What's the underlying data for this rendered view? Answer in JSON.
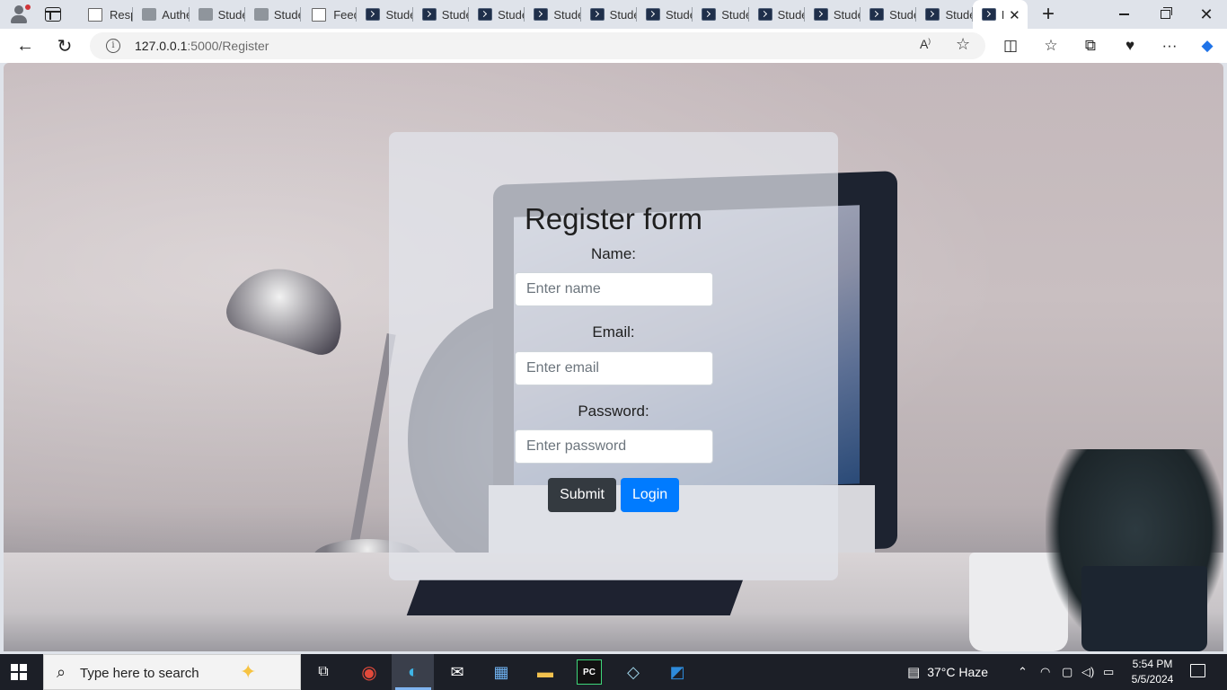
{
  "browser": {
    "tabs": [
      {
        "label": "Respo",
        "icon": "page-icon"
      },
      {
        "label": "Authe",
        "icon": "page-icon"
      },
      {
        "label": "Stude",
        "icon": "page-icon"
      },
      {
        "label": "Stude",
        "icon": "page-icon"
      },
      {
        "label": "Feedb",
        "icon": "page-icon"
      },
      {
        "label": "Stude",
        "icon": "terminal-icon"
      },
      {
        "label": "Stude",
        "icon": "terminal-icon"
      },
      {
        "label": "Stude",
        "icon": "terminal-icon"
      },
      {
        "label": "Stude",
        "icon": "terminal-icon"
      },
      {
        "label": "Stude",
        "icon": "terminal-icon"
      },
      {
        "label": "Stude",
        "icon": "terminal-icon"
      },
      {
        "label": "Stude",
        "icon": "terminal-icon"
      },
      {
        "label": "Stude",
        "icon": "terminal-icon"
      },
      {
        "label": "Stude",
        "icon": "terminal-icon"
      },
      {
        "label": "Stude",
        "icon": "terminal-icon"
      },
      {
        "label": "Stude",
        "icon": "terminal-icon"
      },
      {
        "label": "I",
        "icon": "terminal-icon",
        "active": true
      }
    ],
    "new_tab_symbol": "+",
    "url_host": "127.0.0.1",
    "url_path": ":5000/Register"
  },
  "page": {
    "title": "Register form",
    "name_label": "Name:",
    "name_placeholder": "Enter name",
    "email_label": "Email:",
    "email_placeholder": "Enter email",
    "password_label": "Password:",
    "password_placeholder": "Enter password",
    "submit_label": "Submit",
    "login_label": "Login",
    "submit_color": "#343a40",
    "login_color": "#007bff"
  },
  "taskbar": {
    "search_placeholder": "Type here to search",
    "weather": "37°C  Haze",
    "time": "5:54 PM",
    "date": "5/5/2024"
  }
}
